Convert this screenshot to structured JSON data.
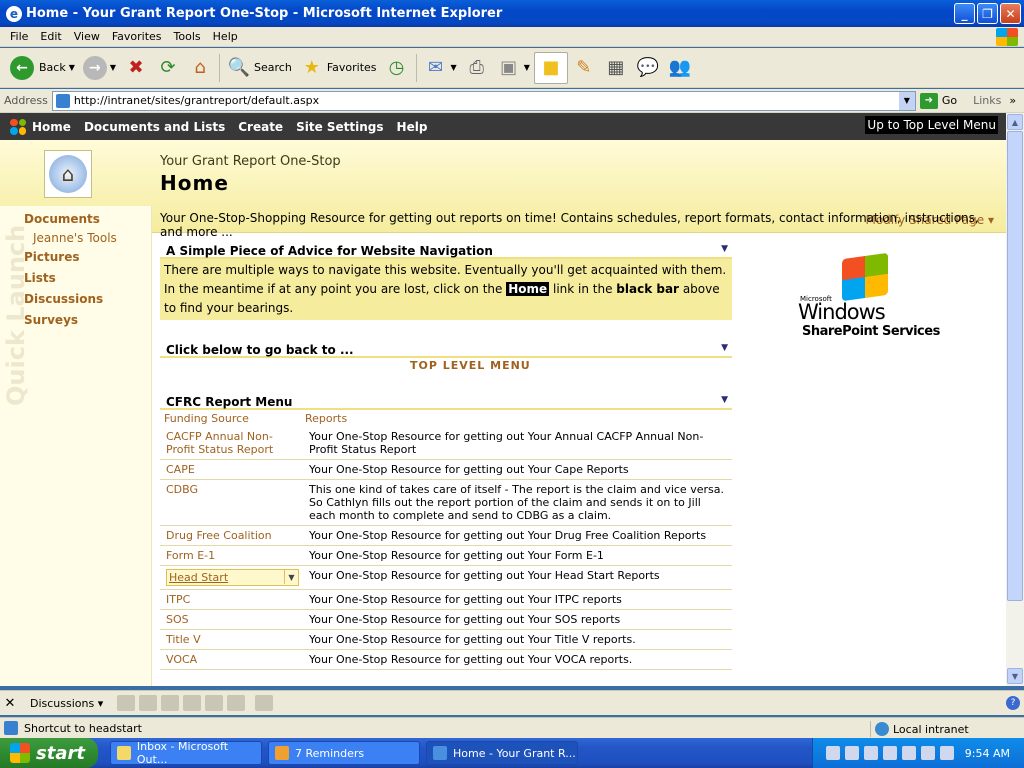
{
  "window": {
    "title": "Home - Your Grant Report One-Stop - Microsoft Internet Explorer",
    "minimize": "_",
    "restore": "❐",
    "close": "✕"
  },
  "menu": [
    "File",
    "Edit",
    "View",
    "Favorites",
    "Tools",
    "Help"
  ],
  "toolbar": {
    "back": "Back",
    "search": "Search",
    "favorites": "Favorites"
  },
  "address": {
    "label": "Address",
    "url": "http://intranet/sites/grantreport/default.aspx",
    "go": "Go",
    "links": "Links"
  },
  "sp_topnav": {
    "items": [
      "Home",
      "Documents and Lists",
      "Create",
      "Site Settings",
      "Help"
    ],
    "up_link": "Up to Top Level Menu"
  },
  "banner": {
    "site_name": "Your Grant Report One-Stop",
    "page_title": "Home",
    "modify": "Modify Shared Page ▾"
  },
  "quick_launch": {
    "watermark": "Quick Launch",
    "items": [
      "Documents",
      "Jeanne's Tools",
      "Pictures",
      "Lists",
      "Discussions",
      "Surveys"
    ]
  },
  "intro": "Your One-Stop-Shopping Resource for getting out reports on time! Contains schedules, report formats, contact information, instructions, and more ...",
  "advice": {
    "heading": "A Simple Piece of Advice for Website Navigation",
    "text1": "There are multiple ways to navigate this website. Eventually you'll get acquainted with them. In the meantime if at any point you are lost, click on the",
    "home_word": "Home",
    "text2": "link in the",
    "black_bar": "black bar",
    "text3": "above to find your bearings."
  },
  "goback": {
    "heading": "Click below to go back to ...",
    "link": "TOP LEVEL MENU"
  },
  "wss_logo": {
    "ms": "Microsoft",
    "windows": "Windows",
    "sps": "SharePoint Services"
  },
  "report_menu": {
    "heading": "CFRC Report Menu",
    "columns": [
      "Funding Source",
      "Reports"
    ],
    "rows": [
      {
        "source": "CACFP Annual Non-Profit Status Report",
        "report": "Your One-Stop Resource for getting out Your Annual CACFP Annual Non-Profit Status Report"
      },
      {
        "source": "CAPE",
        "report": "Your One-Stop Resource for getting out Your Cape Reports"
      },
      {
        "source": "CDBG",
        "report": "This one kind of takes care of itself - The report is the claim and vice versa. So Cathlyn fills out the report portion of the claim and sends it on to Jill each month to complete and send to CDBG as a claim."
      },
      {
        "source": "Drug Free Coalition",
        "report": "Your One-Stop Resource for getting out Your Drug Free Coalition Reports"
      },
      {
        "source": "Form E-1",
        "report": "Your One-Stop Resource for getting out Your Form E-1"
      },
      {
        "source": "Head Start",
        "report": "Your One-Stop Resource for getting out Your Head Start Reports"
      },
      {
        "source": "ITPC",
        "report": "Your One-Stop Resource for getting out Your ITPC reports"
      },
      {
        "source": "SOS",
        "report": "Your One-Stop Resource for getting out Your SOS reports"
      },
      {
        "source": "Title V",
        "report": "Your One-Stop Resource for getting out Your Title V reports."
      },
      {
        "source": "VOCA",
        "report": "Your One-Stop Resource for getting out Your VOCA reports."
      }
    ]
  },
  "discussions_bar": {
    "close": "✕",
    "label": "Discussions ▾"
  },
  "status": {
    "text": "Shortcut to headstart",
    "zone": "Local intranet"
  },
  "taskbar": {
    "start": "start",
    "tasks": [
      "Inbox - Microsoft Out...",
      "7 Reminders",
      "Home - Your Grant R..."
    ],
    "clock": "9:54 AM"
  }
}
